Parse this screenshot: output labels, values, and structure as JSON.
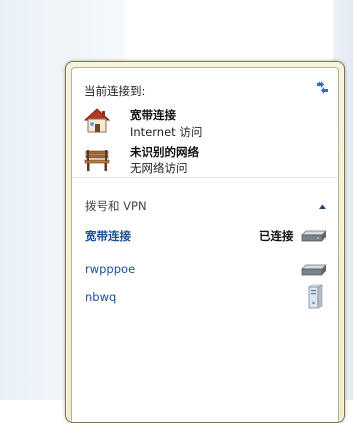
{
  "current_connection_label": "当前连接到:",
  "networks": [
    {
      "title": "宽带连接",
      "subtitle": "Internet 访问",
      "icon": "house-icon"
    },
    {
      "title": "未识别的网络",
      "subtitle": "无网络访问",
      "icon": "park-bench-icon"
    }
  ],
  "dialup_group": {
    "title": "拨号和 VPN",
    "connections": [
      {
        "name": "宽带连接",
        "status": "已连接",
        "icon": "modem-icon"
      },
      {
        "name": "rwpppoe",
        "status": "",
        "icon": "modem-icon"
      },
      {
        "name": "nbwq",
        "status": "",
        "icon": "vpn-server-icon"
      }
    ]
  }
}
